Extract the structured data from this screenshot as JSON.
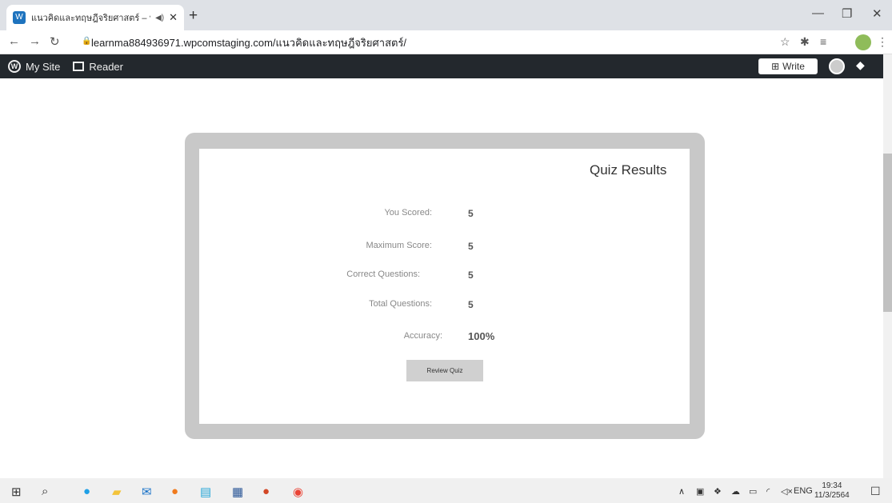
{
  "browser": {
    "tab_title": "แนวคิดและทฤษฎีจริยศาสตร์ – ฟั",
    "tab_favicon": "wordpress-icon",
    "url": "learnma884936971.wpcomstaging.com/แนวคิดและทฤษฎีจริยศาสตร์/"
  },
  "wp_admin_bar": {
    "my_site": "My Site",
    "reader": "Reader",
    "write": "Write"
  },
  "quiz": {
    "title": "Quiz Results",
    "rows": [
      {
        "label": "You Scored:",
        "value": "5"
      },
      {
        "label": "Maximum Score:",
        "value": "5"
      },
      {
        "label": "Correct Questions:",
        "value": "5"
      },
      {
        "label": "Total Questions:",
        "value": "5"
      },
      {
        "label": "Accuracy:",
        "value": "100%"
      }
    ],
    "review_button": "Review Quiz"
  },
  "system": {
    "language": "ENG",
    "time": "19:34",
    "date": "11/3/2564"
  }
}
